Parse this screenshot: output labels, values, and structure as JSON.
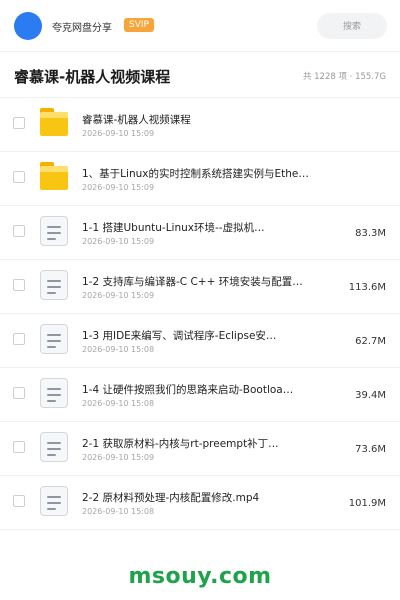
{
  "header": {
    "app_name": "夸克网盘分享",
    "badge": "SVIP",
    "search_placeholder": "搜索"
  },
  "folder": {
    "title": "睿慕课-机器人视频课程",
    "summary": "共 1228 项 · 155.7G"
  },
  "files": [
    {
      "type": "folder",
      "name": "睿慕课-机器人视频课程",
      "date": "2026-09-10 15:09",
      "size": ""
    },
    {
      "type": "folder",
      "name": "1、基于Linux的实时控制系统搭建实例与Ethe…",
      "date": "2026-09-10 15:09",
      "size": ""
    },
    {
      "type": "file",
      "name": "1-1 搭建Ubuntu-Linux环境--虚拟机…",
      "date": "2026-09-10 15:09",
      "size": "83.3M"
    },
    {
      "type": "file",
      "name": "1-2 支持库与编译器-C C++ 环境安装与配置…",
      "date": "2026-09-10 15:09",
      "size": "113.6M"
    },
    {
      "type": "file",
      "name": "1-3 用IDE来编写、调试程序-Eclipse安…",
      "date": "2026-09-10 15:08",
      "size": "62.7M"
    },
    {
      "type": "file",
      "name": "1-4 让硬件按照我们的思路来启动-Bootloa…",
      "date": "2026-09-10 15:08",
      "size": "39.4M"
    },
    {
      "type": "file",
      "name": "2-1 获取原材料-内核与rt-preempt补丁…",
      "date": "2026-09-10 15:09",
      "size": "73.6M"
    },
    {
      "type": "file",
      "name": "2-2 原材料预处理-内核配置修改.mp4",
      "date": "2026-09-10 15:08",
      "size": "101.9M"
    }
  ],
  "watermark": "msouy.com",
  "colors": {
    "avatar": "#2b7bf2",
    "svip_badge": "#f7a53b",
    "folder_yellow": "#f8c513",
    "watermark_green": "#1fa34a"
  },
  "icons": {
    "folder": "folder-icon",
    "file": "document-icon"
  }
}
